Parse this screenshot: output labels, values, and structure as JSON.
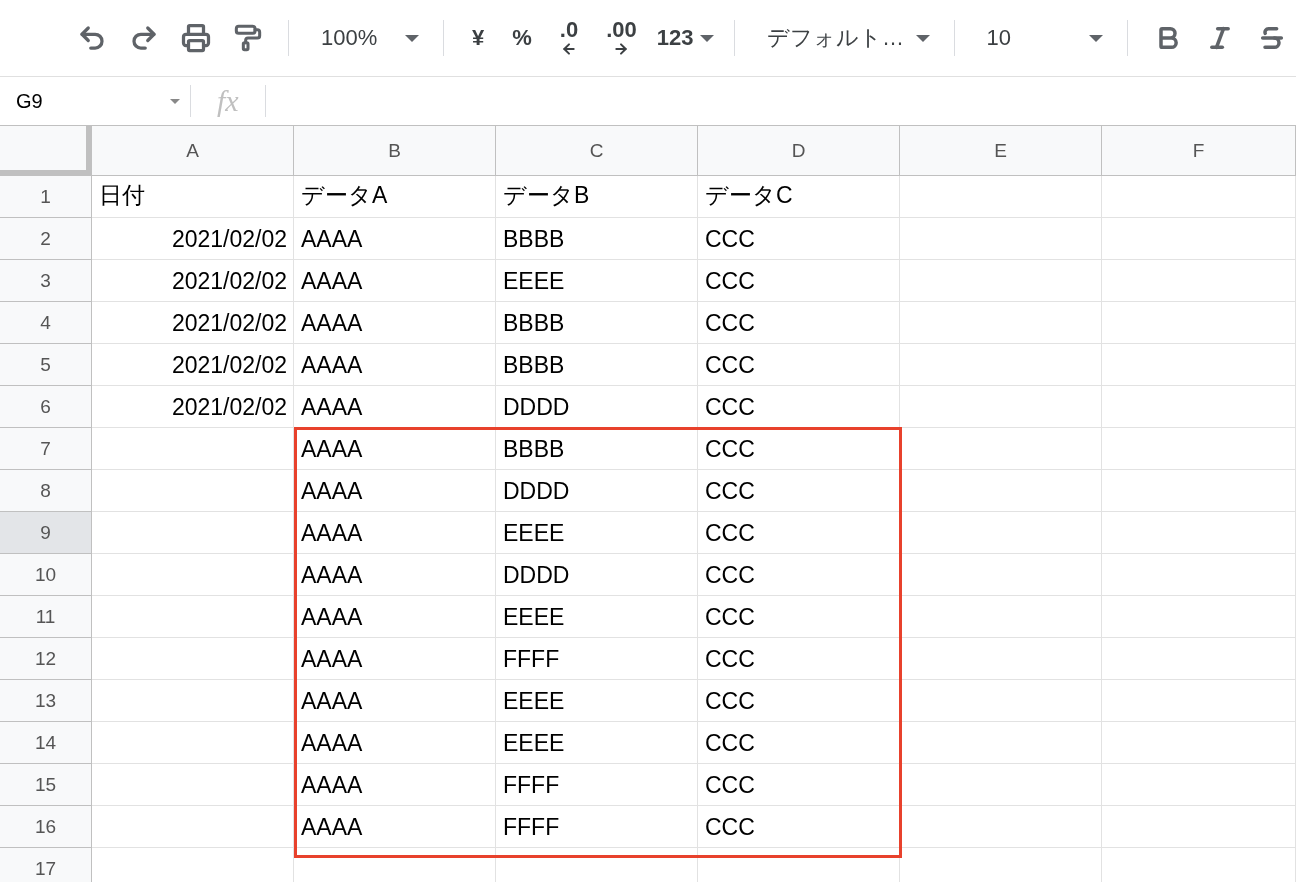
{
  "toolbar": {
    "zoom": "100%",
    "currency": "¥",
    "percent": "%",
    "decrease_decimals": ".0",
    "increase_decimals": ".00",
    "more_formats": "123",
    "font": "デフォルト…",
    "font_size": "10"
  },
  "formula_bar": {
    "cell_ref": "G9",
    "fx": "fx"
  },
  "columns": [
    {
      "label": "A",
      "selected": false
    },
    {
      "label": "B",
      "selected": false
    },
    {
      "label": "C",
      "selected": false
    },
    {
      "label": "D",
      "selected": false
    },
    {
      "label": "E",
      "selected": false
    },
    {
      "label": "F",
      "selected": false
    }
  ],
  "rows": [
    {
      "number": "1",
      "selected": false,
      "cells": [
        "日付",
        "データA",
        "データB",
        "データC",
        "",
        ""
      ]
    },
    {
      "number": "2",
      "selected": false,
      "cells": [
        "2021/02/02",
        "AAAA",
        "BBBB",
        "CCC",
        "",
        ""
      ]
    },
    {
      "number": "3",
      "selected": false,
      "cells": [
        "2021/02/02",
        "AAAA",
        "EEEE",
        "CCC",
        "",
        ""
      ]
    },
    {
      "number": "4",
      "selected": false,
      "cells": [
        "2021/02/02",
        "AAAA",
        "BBBB",
        "CCC",
        "",
        ""
      ]
    },
    {
      "number": "5",
      "selected": false,
      "cells": [
        "2021/02/02",
        "AAAA",
        "BBBB",
        "CCC",
        "",
        ""
      ]
    },
    {
      "number": "6",
      "selected": false,
      "cells": [
        "2021/02/02",
        "AAAA",
        "DDDD",
        "CCC",
        "",
        ""
      ]
    },
    {
      "number": "7",
      "selected": false,
      "cells": [
        "",
        "AAAA",
        "BBBB",
        "CCC",
        "",
        ""
      ]
    },
    {
      "number": "8",
      "selected": false,
      "cells": [
        "",
        "AAAA",
        "DDDD",
        "CCC",
        "",
        ""
      ]
    },
    {
      "number": "9",
      "selected": true,
      "cells": [
        "",
        "AAAA",
        "EEEE",
        "CCC",
        "",
        ""
      ]
    },
    {
      "number": "10",
      "selected": false,
      "cells": [
        "",
        "AAAA",
        "DDDD",
        "CCC",
        "",
        ""
      ]
    },
    {
      "number": "11",
      "selected": false,
      "cells": [
        "",
        "AAAA",
        "EEEE",
        "CCC",
        "",
        ""
      ]
    },
    {
      "number": "12",
      "selected": false,
      "cells": [
        "",
        "AAAA",
        "FFFF",
        "CCC",
        "",
        ""
      ]
    },
    {
      "number": "13",
      "selected": false,
      "cells": [
        "",
        "AAAA",
        "EEEE",
        "CCC",
        "",
        ""
      ]
    },
    {
      "number": "14",
      "selected": false,
      "cells": [
        "",
        "AAAA",
        "EEEE",
        "CCC",
        "",
        ""
      ]
    },
    {
      "number": "15",
      "selected": false,
      "cells": [
        "",
        "AAAA",
        "FFFF",
        "CCC",
        "",
        ""
      ]
    },
    {
      "number": "16",
      "selected": false,
      "cells": [
        "",
        "AAAA",
        "FFFF",
        "CCC",
        "",
        ""
      ]
    },
    {
      "number": "17",
      "selected": false,
      "cells": [
        "",
        "",
        "",
        "",
        "",
        ""
      ]
    }
  ]
}
